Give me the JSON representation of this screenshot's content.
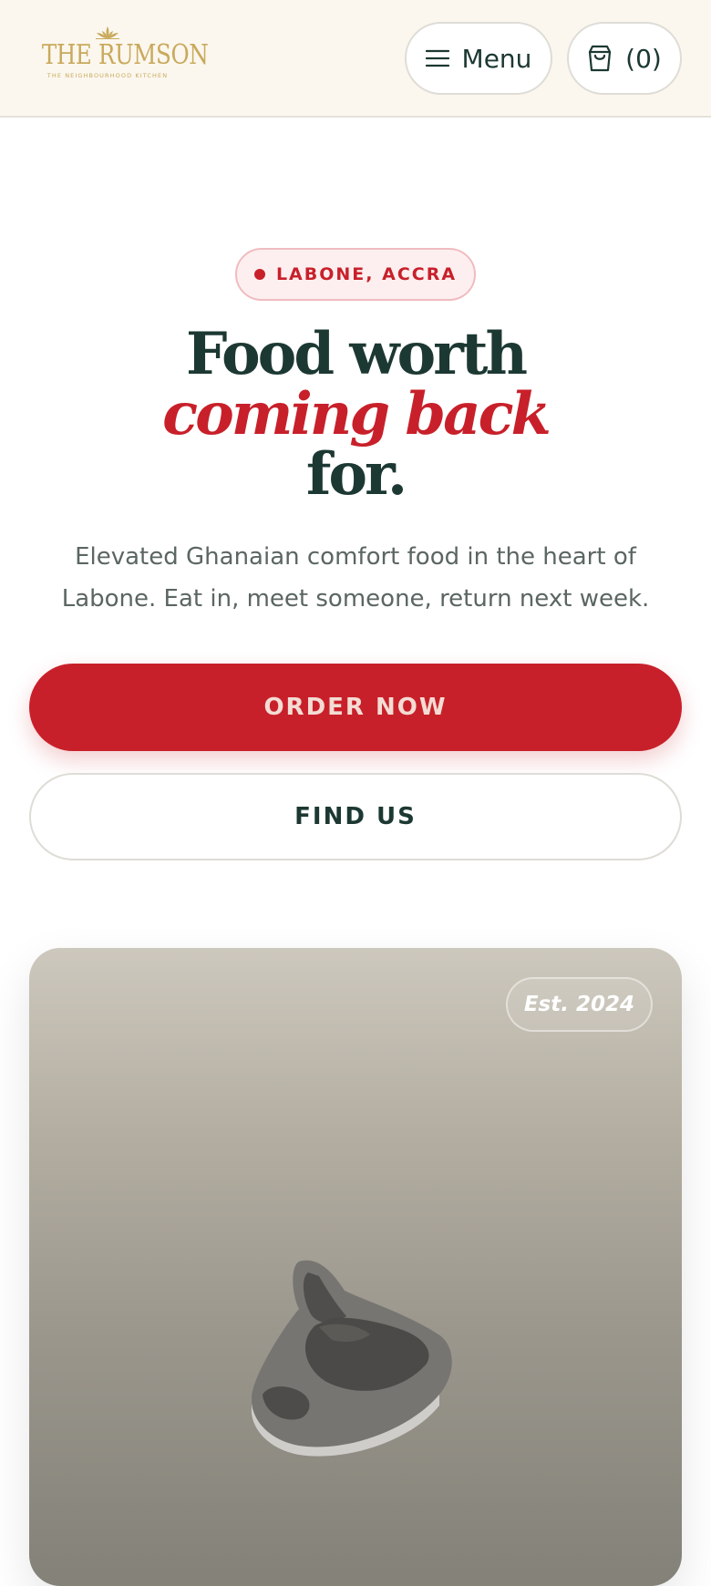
{
  "header": {
    "logo_name": "THE RUMSON",
    "logo_tagline": "THE NEIGHBOURHOOD KITCHEN",
    "menu_label": "Menu",
    "cart_count": "(0)"
  },
  "hero": {
    "location": "LABONE, ACCRA",
    "headline_line1": "Food worth",
    "headline_line2": "coming back",
    "headline_line3": "for.",
    "subtext": "Elevated Ghanaian comfort food in the heart of Labone. Eat in, meet someone, return next week.",
    "primary_cta": "ORDER NOW",
    "secondary_cta": "FIND US"
  },
  "image_card": {
    "badge": "Est. 2024",
    "image_subject": "steak"
  },
  "colors": {
    "brand_red": "#c8202a",
    "dark_green": "#1c3832",
    "gold": "#c9a95c",
    "header_bg": "#fbf7ee"
  },
  "icons": [
    "hamburger-icon",
    "shopping-bag-icon",
    "lotus-icon",
    "location-dot-icon"
  ]
}
